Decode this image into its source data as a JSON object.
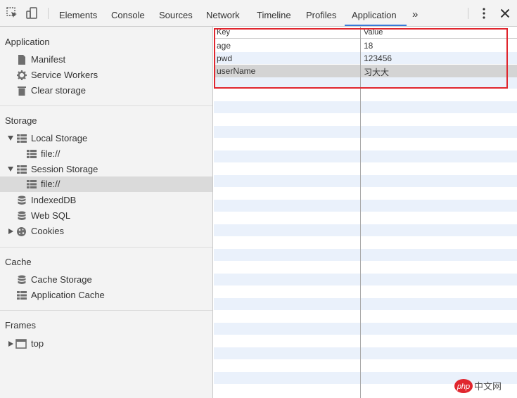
{
  "toolbar": {
    "tabs": [
      {
        "label": "Elements"
      },
      {
        "label": "Console"
      },
      {
        "label": "Sources"
      },
      {
        "label": "Network"
      },
      {
        "label": "Timeline"
      },
      {
        "label": "Profiles"
      },
      {
        "label": "Application"
      }
    ],
    "active_tab": "Application",
    "more_tabs_glyph": "»",
    "menu_glyph": "⋮",
    "close_glyph": "✕",
    "icons": [
      "inspect-element-icon",
      "device-mode-icon",
      "more-tabs-icon",
      "kebab-menu-icon",
      "close-icon"
    ]
  },
  "sidebar": {
    "sections": [
      {
        "title": "Application"
      },
      {
        "title": "Storage"
      },
      {
        "title": "Cache"
      },
      {
        "title": "Frames"
      }
    ],
    "application_items": [
      {
        "label": "Manifest",
        "icon": "document-icon"
      },
      {
        "label": "Service Workers",
        "icon": "gear-icon"
      },
      {
        "label": "Clear storage",
        "icon": "trash-icon"
      }
    ],
    "storage_items": [
      {
        "label": "Local Storage",
        "icon": "table-icon",
        "expanded": true
      },
      {
        "label": "file://",
        "icon": "table-icon"
      },
      {
        "label": "Session Storage",
        "icon": "table-icon",
        "expanded": true
      },
      {
        "label": "file://",
        "icon": "table-icon",
        "selected": true
      },
      {
        "label": "IndexedDB",
        "icon": "database-icon"
      },
      {
        "label": "Web SQL",
        "icon": "database-icon"
      },
      {
        "label": "Cookies",
        "icon": "cookie-icon",
        "expanded": false
      }
    ],
    "cache_items": [
      {
        "label": "Cache Storage",
        "icon": "database-icon"
      },
      {
        "label": "Application Cache",
        "icon": "table-icon"
      }
    ],
    "frames_items": [
      {
        "label": "top",
        "icon": "frame-icon",
        "expanded": false
      }
    ]
  },
  "table": {
    "columns": [
      "Key",
      "Value"
    ],
    "rows": [
      {
        "key": "age",
        "value": "18"
      },
      {
        "key": "pwd",
        "value": "123456"
      },
      {
        "key": "userName",
        "value": "习大大"
      }
    ],
    "selected_row": "userName"
  },
  "watermark": {
    "text": "php中文网",
    "color": "#e0262e"
  },
  "colors": {
    "accent": "#3879d9",
    "highlight": "#e0262e",
    "stripe": "#eaf1fb",
    "sidebar_bg": "#f3f3f3",
    "selected_bg": "#dadada"
  }
}
